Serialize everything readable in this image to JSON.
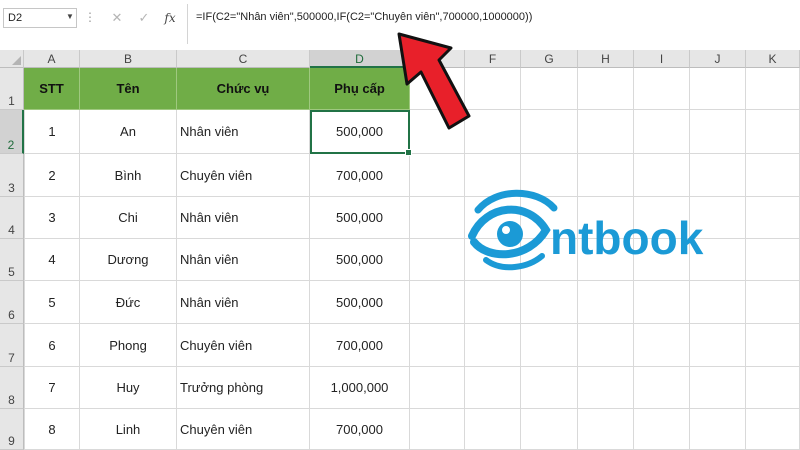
{
  "formula_bar": {
    "name_box": "D2",
    "name_box_arrow_icon": "chevron-down-icon",
    "cancel_icon": "close-icon",
    "confirm_icon": "check-icon",
    "fx_label": "fx",
    "formula": "=IF(C2=\"Nhân viên\",500000,IF(C2=\"Chuyên viên\",700000,1000000))"
  },
  "columns": [
    "A",
    "B",
    "C",
    "D",
    "E",
    "F",
    "G",
    "H",
    "I",
    "J",
    "K"
  ],
  "rows": [
    "1",
    "2",
    "3",
    "4",
    "5",
    "6",
    "7",
    "8",
    "9"
  ],
  "table": {
    "headers": [
      "STT",
      "Tên",
      "Chức vụ",
      "Phụ cấp"
    ],
    "rows": [
      [
        "1",
        "An",
        "Nhân viên",
        "500,000"
      ],
      [
        "2",
        "Bình",
        "Chuyên viên",
        "700,000"
      ],
      [
        "3",
        "Chi",
        "Nhân viên",
        "500,000"
      ],
      [
        "4",
        "Dương",
        "Nhân viên",
        "500,000"
      ],
      [
        "5",
        "Đức",
        "Nhân viên",
        "500,000"
      ],
      [
        "6",
        "Phong",
        "Chuyên viên",
        "700,000"
      ],
      [
        "7",
        "Huy",
        "Trưởng phòng",
        "1,000,000"
      ],
      [
        "8",
        "Linh",
        "Chuyên viên",
        "700,000"
      ]
    ]
  },
  "logo": {
    "text": "ntbook",
    "icon": "eye-logo-icon",
    "color": "#1b9ad6"
  },
  "colors": {
    "header_fill": "#70ad47",
    "selection": "#217346",
    "arrow": "#e8202a"
  }
}
